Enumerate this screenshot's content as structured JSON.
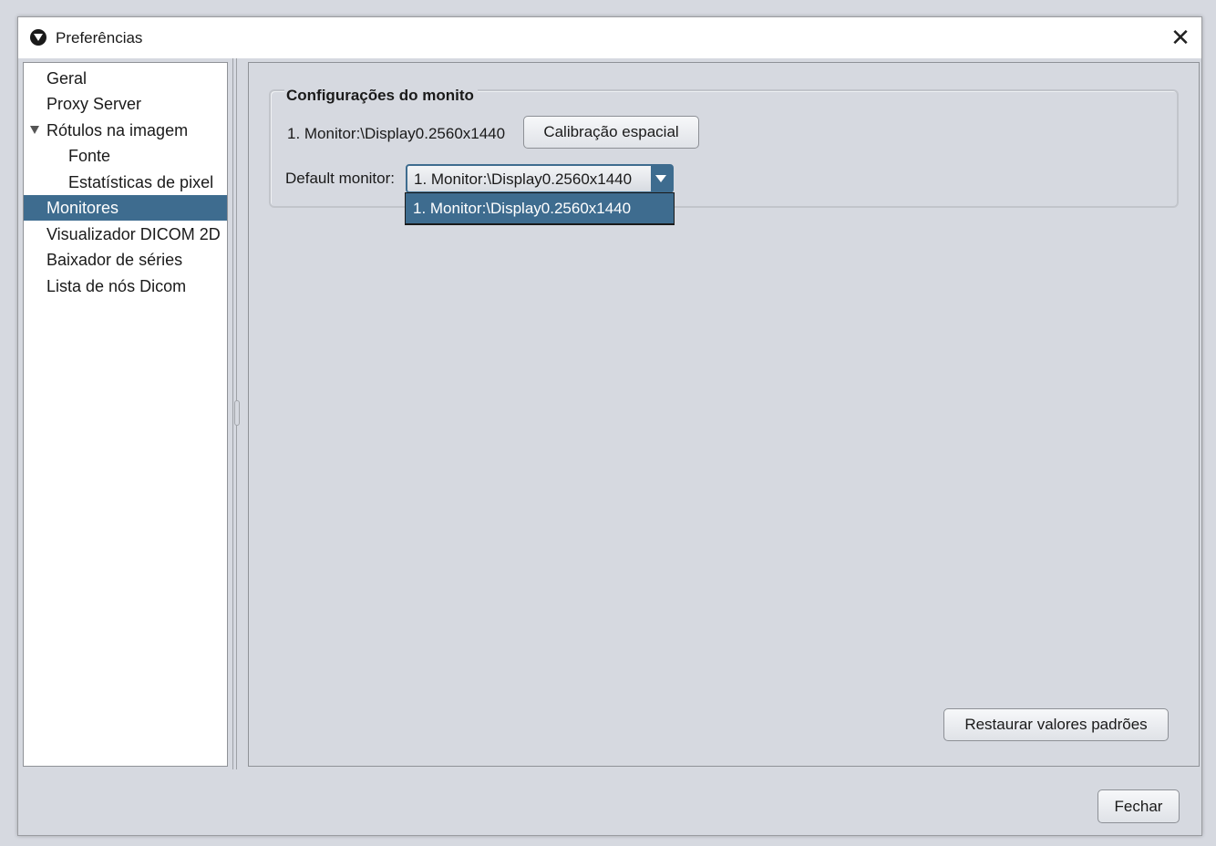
{
  "window": {
    "title": "Preferências",
    "app_icon": "app-logo-icon",
    "close_icon": "close-icon",
    "close_glyph": "✕"
  },
  "tree": {
    "items": [
      {
        "label": "Geral",
        "level": 0,
        "selected": false
      },
      {
        "label": "Proxy Server",
        "level": 0,
        "selected": false
      },
      {
        "label": "Rótulos na imagem",
        "level": 0,
        "selected": false,
        "expanded": true
      },
      {
        "label": "Fonte",
        "level": 1,
        "selected": false
      },
      {
        "label": "Estatísticas de pixel",
        "level": 1,
        "selected": false
      },
      {
        "label": "Monitores",
        "level": 0,
        "selected": true
      },
      {
        "label": "Visualizador DICOM 2D",
        "level": 0,
        "selected": false
      },
      {
        "label": "Baixador de séries",
        "level": 0,
        "selected": false
      },
      {
        "label": "Lista de nós Dicom",
        "level": 0,
        "selected": false
      }
    ]
  },
  "monitors": {
    "group_title": "Configurações do monito",
    "monitor_label": "1. Monitor:\\Display0.2560x1440",
    "calibration_button": "Calibração espacial",
    "default_monitor_label": "Default monitor:",
    "default_monitor_value": "1. Monitor:\\Display0.2560x1440",
    "dropdown_options": [
      "1. Monitor:\\Display0.2560x1440"
    ],
    "restore_button": "Restaurar valores padrões"
  },
  "footer": {
    "close_button": "Fechar"
  },
  "colors": {
    "selection": "#3e6c8f",
    "background": "#d6d9e0"
  }
}
